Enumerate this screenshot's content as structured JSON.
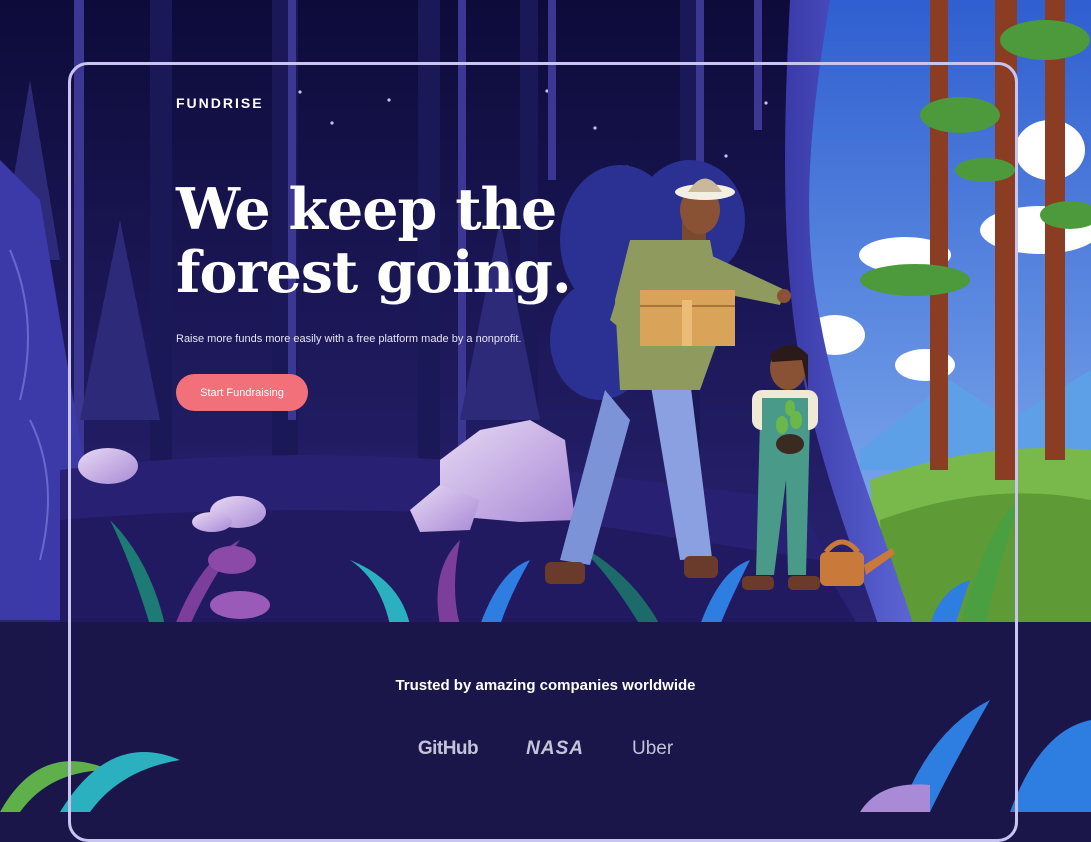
{
  "brand": "FUNDRISE",
  "hero": {
    "headline_line1": "We keep the",
    "headline_line2": "forest going.",
    "subtitle": "Raise more funds more easily with a free platform made by a nonprofit.",
    "cta_label": "Start Fundraising"
  },
  "trust": {
    "heading": "Trusted by amazing companies worldwide",
    "logos": [
      "GitHub",
      "NASA",
      "Uber"
    ]
  },
  "colors": {
    "night_sky": "#0d0b3a",
    "page_bg": "#1a164a",
    "cta": "#f2707a",
    "text": "#ffffff",
    "day_sky": "#3f6fd9",
    "grass": "#79b84a"
  },
  "illustration": {
    "icons": [
      "forest-illustration",
      "man-with-box",
      "girl-with-sapling",
      "watering-can-icon",
      "curtain-reveal"
    ]
  }
}
